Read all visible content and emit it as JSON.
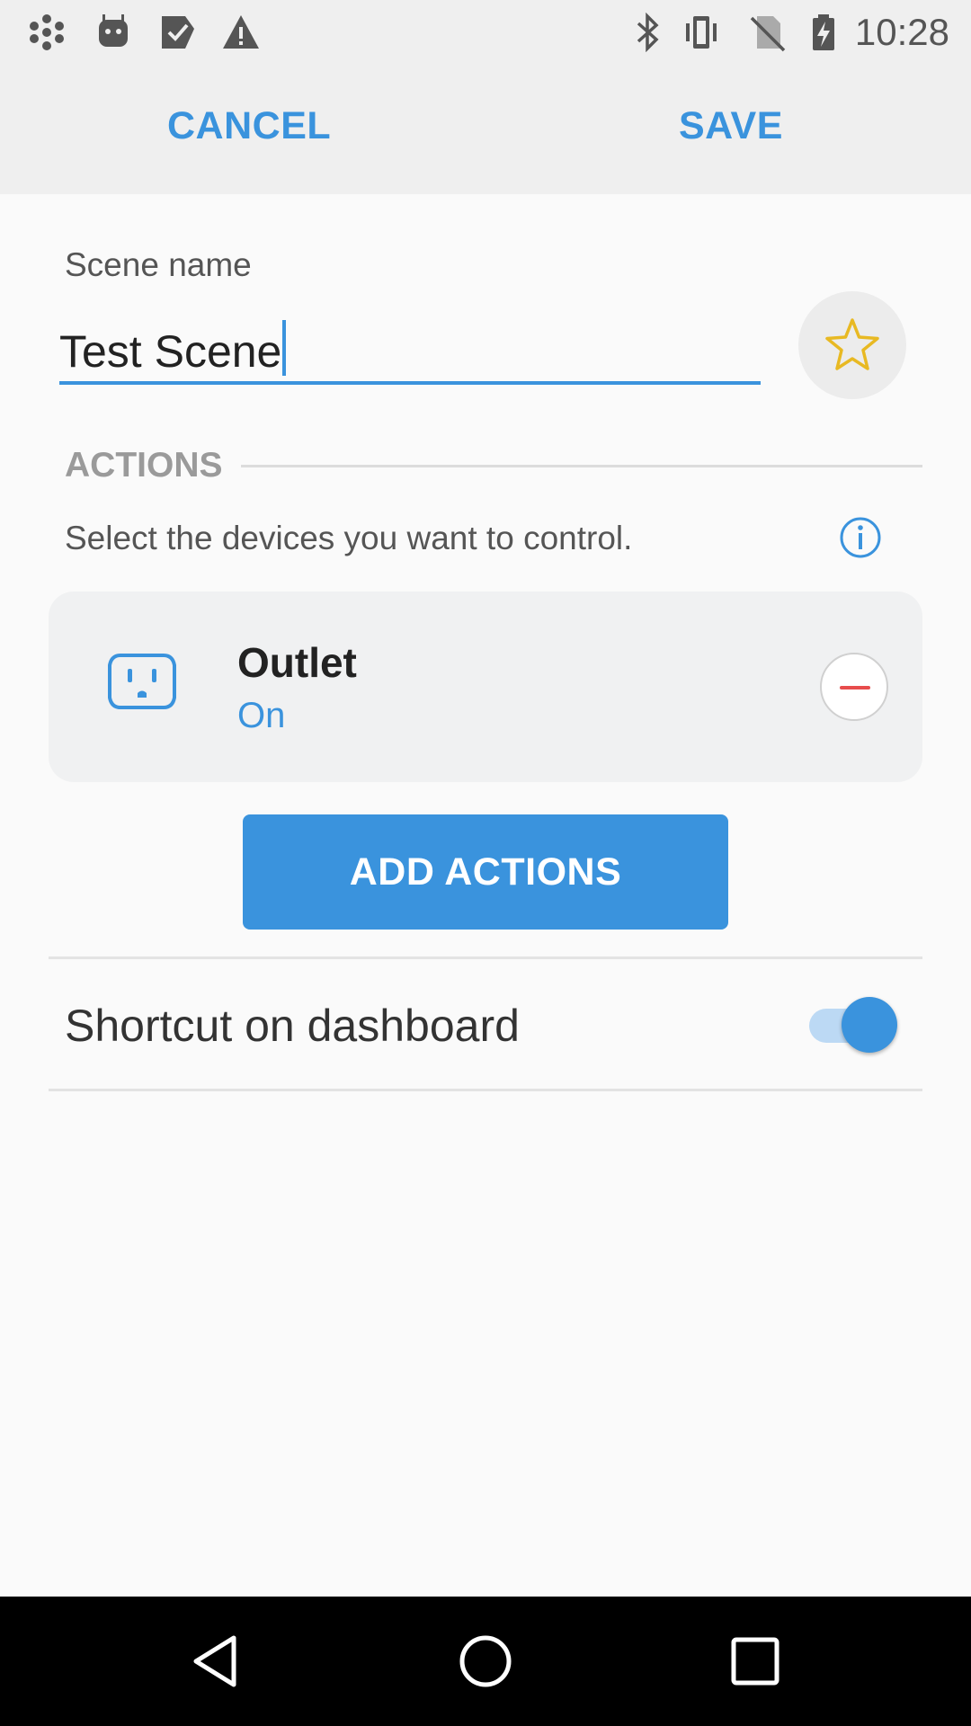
{
  "status_bar": {
    "time": "10:28",
    "left_icons": [
      "network-hub-icon",
      "android-debug-icon",
      "task-check-icon",
      "warning-icon"
    ],
    "right_icons": [
      "bluetooth-icon",
      "vibrate-icon",
      "no-sim-icon",
      "battery-charging-icon"
    ]
  },
  "toolbar": {
    "cancel_label": "CANCEL",
    "save_label": "SAVE"
  },
  "scene": {
    "name_label": "Scene name",
    "name_value": "Test Scene",
    "favorite_icon": "star-icon",
    "accent": "#3a93dd",
    "star_color": "#e8b923"
  },
  "actions": {
    "heading": "ACTIONS",
    "description": "Select the devices you want to control.",
    "items": [
      {
        "name": "Outlet",
        "state": "On",
        "icon": "outlet-icon"
      }
    ],
    "add_label": "ADD ACTIONS"
  },
  "shortcut": {
    "label": "Shortcut on dashboard",
    "enabled": true
  },
  "nav_bar": {
    "buttons": [
      "back-icon",
      "home-icon",
      "recents-icon"
    ]
  }
}
